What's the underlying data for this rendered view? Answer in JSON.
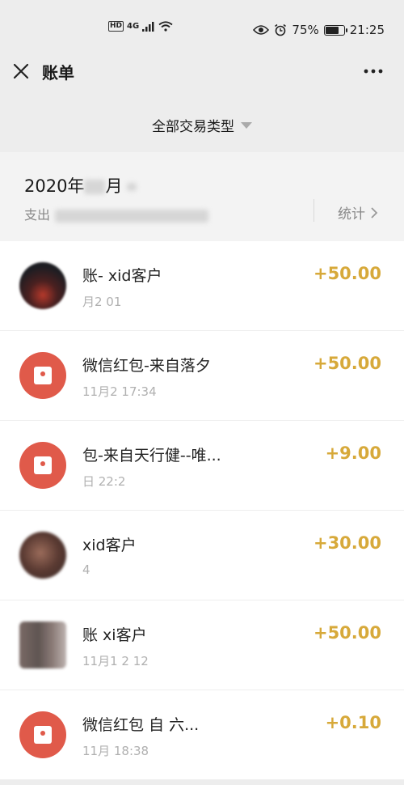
{
  "status_bar": {
    "network_hd": "HD",
    "network_4g": "4G",
    "battery": "75%",
    "battery_level": 0.75,
    "time": "21:25"
  },
  "header": {
    "title": "账单"
  },
  "filter": {
    "label": "全部交易类型"
  },
  "month": {
    "title_prefix": "2020年",
    "title_rest": "月",
    "summary_prefix": "支出",
    "stats_label": "统计"
  },
  "transactions": [
    {
      "title": "账-  xid客户",
      "time": "月2 01",
      "amount": "+50.00",
      "avatar": "photo-dark"
    },
    {
      "title": "微信红包-来自落夕",
      "time": "11月2  17:34",
      "amount": "+50.00",
      "avatar": "redpacket"
    },
    {
      "title": "包-来自天行健--唯...",
      "time": "日 22:2",
      "amount": "+9.00",
      "avatar": "redpacket"
    },
    {
      "title": "xid客户",
      "time": "4",
      "amount": "+30.00",
      "avatar": "photo-brown"
    },
    {
      "title": "账 xi客户",
      "time": "11月1 2 12",
      "amount": "+50.00",
      "avatar": "photo-grey"
    },
    {
      "title": "微信红包 自 六...",
      "time": "11月 18:38",
      "amount": "+0.10",
      "avatar": "redpacket"
    }
  ]
}
